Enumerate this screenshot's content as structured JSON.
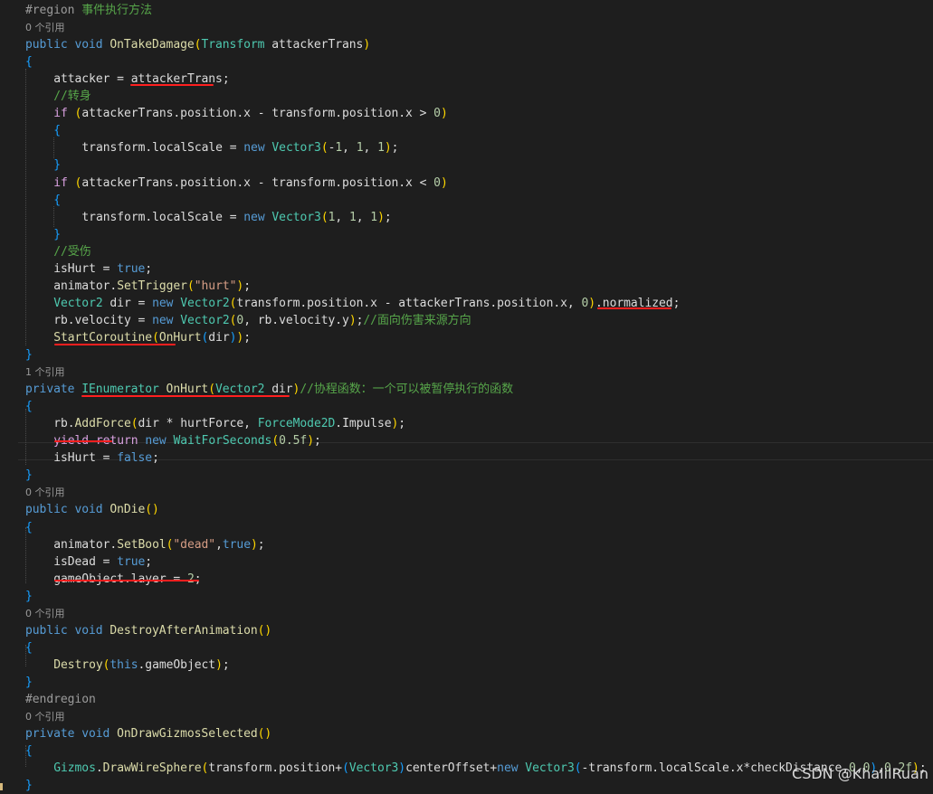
{
  "editor": {
    "colors": {
      "background": "#1e1e1e",
      "keyword": "#569cd6",
      "control": "#d8a0df",
      "type": "#4ec9b0",
      "method": "#dcdcaa",
      "comment": "#57a64a",
      "string": "#d69d85",
      "number": "#b5cea8",
      "annotation": "#ff1f1f"
    },
    "lines": [
      {
        "kind": "code",
        "indent": 0,
        "tokens": [
          [
            "pre",
            "#region "
          ],
          [
            "cmt",
            "事件执行方法"
          ]
        ]
      },
      {
        "kind": "lens",
        "text": "0 个引用"
      },
      {
        "kind": "code",
        "indent": 0,
        "tokens": [
          [
            "kw",
            "public"
          ],
          [
            "id",
            " "
          ],
          [
            "kw",
            "void"
          ],
          [
            "id",
            " "
          ],
          [
            "method",
            "OnTakeDamage"
          ],
          [
            "br2",
            "("
          ],
          [
            "type",
            "Transform"
          ],
          [
            "id",
            " attackerTrans"
          ],
          [
            "br2",
            ")"
          ]
        ]
      },
      {
        "kind": "code",
        "indent": 0,
        "tokens": [
          [
            "br",
            "{"
          ]
        ]
      },
      {
        "kind": "code",
        "indent": 1,
        "tokens": [
          [
            "id",
            "attacker = attackerTrans;"
          ]
        ]
      },
      {
        "kind": "code",
        "indent": 1,
        "tokens": [
          [
            "cmt",
            "//转身"
          ]
        ]
      },
      {
        "kind": "code",
        "indent": 1,
        "tokens": [
          [
            "ctl",
            "if"
          ],
          [
            "id",
            " "
          ],
          [
            "br2",
            "("
          ],
          [
            "id",
            "attackerTrans.position.x - transform.position.x > "
          ],
          [
            "num",
            "0"
          ],
          [
            "br2",
            ")"
          ]
        ]
      },
      {
        "kind": "code",
        "indent": 1,
        "tokens": [
          [
            "br",
            "{"
          ]
        ]
      },
      {
        "kind": "code",
        "indent": 2,
        "tokens": [
          [
            "id",
            "transform.localScale = "
          ],
          [
            "kw",
            "new"
          ],
          [
            "id",
            " "
          ],
          [
            "type",
            "Vector3"
          ],
          [
            "br2",
            "("
          ],
          [
            "id",
            "-"
          ],
          [
            "num",
            "1"
          ],
          [
            "id",
            ", "
          ],
          [
            "num",
            "1"
          ],
          [
            "id",
            ", "
          ],
          [
            "num",
            "1"
          ],
          [
            "br2",
            ")"
          ],
          [
            "id",
            ";"
          ]
        ]
      },
      {
        "kind": "code",
        "indent": 1,
        "tokens": [
          [
            "br",
            "}"
          ]
        ]
      },
      {
        "kind": "code",
        "indent": 1,
        "tokens": [
          [
            "ctl",
            "if"
          ],
          [
            "id",
            " "
          ],
          [
            "br2",
            "("
          ],
          [
            "id",
            "attackerTrans.position.x - transform.position.x < "
          ],
          [
            "num",
            "0"
          ],
          [
            "br2",
            ")"
          ]
        ]
      },
      {
        "kind": "code",
        "indent": 1,
        "tokens": [
          [
            "br",
            "{"
          ]
        ]
      },
      {
        "kind": "code",
        "indent": 2,
        "tokens": [
          [
            "id",
            "transform.localScale = "
          ],
          [
            "kw",
            "new"
          ],
          [
            "id",
            " "
          ],
          [
            "type",
            "Vector3"
          ],
          [
            "br2",
            "("
          ],
          [
            "num",
            "1"
          ],
          [
            "id",
            ", "
          ],
          [
            "num",
            "1"
          ],
          [
            "id",
            ", "
          ],
          [
            "num",
            "1"
          ],
          [
            "br2",
            ")"
          ],
          [
            "id",
            ";"
          ]
        ]
      },
      {
        "kind": "code",
        "indent": 1,
        "tokens": [
          [
            "br",
            "}"
          ]
        ]
      },
      {
        "kind": "code",
        "indent": 1,
        "tokens": [
          [
            "cmt",
            "//受伤"
          ]
        ]
      },
      {
        "kind": "code",
        "indent": 1,
        "tokens": [
          [
            "id",
            "isHurt = "
          ],
          [
            "kw",
            "true"
          ],
          [
            "id",
            ";"
          ]
        ]
      },
      {
        "kind": "code",
        "indent": 1,
        "tokens": [
          [
            "id",
            "animator."
          ],
          [
            "method",
            "SetTrigger"
          ],
          [
            "br2",
            "("
          ],
          [
            "str",
            "\"hurt\""
          ],
          [
            "br2",
            ")"
          ],
          [
            "id",
            ";"
          ]
        ]
      },
      {
        "kind": "code",
        "indent": 1,
        "tokens": [
          [
            "type",
            "Vector2"
          ],
          [
            "id",
            " dir = "
          ],
          [
            "kw",
            "new"
          ],
          [
            "id",
            " "
          ],
          [
            "type",
            "Vector2"
          ],
          [
            "br2",
            "("
          ],
          [
            "id",
            "transform.position.x - attackerTrans.position.x, "
          ],
          [
            "num",
            "0"
          ],
          [
            "br2",
            ")"
          ],
          [
            "id",
            ".normalized;"
          ]
        ]
      },
      {
        "kind": "code",
        "indent": 1,
        "tokens": [
          [
            "id",
            "rb.velocity = "
          ],
          [
            "kw",
            "new"
          ],
          [
            "id",
            " "
          ],
          [
            "type",
            "Vector2"
          ],
          [
            "br2",
            "("
          ],
          [
            "num",
            "0"
          ],
          [
            "id",
            ", rb.velocity.y"
          ],
          [
            "br2",
            ")"
          ],
          [
            "id",
            ";"
          ],
          [
            "cmt",
            "//面向伤害来源方向"
          ]
        ]
      },
      {
        "kind": "code",
        "indent": 1,
        "tokens": [
          [
            "method",
            "StartCoroutine"
          ],
          [
            "br2",
            "("
          ],
          [
            "method",
            "OnHurt"
          ],
          [
            "br",
            "("
          ],
          [
            "id",
            "dir"
          ],
          [
            "br",
            ")"
          ],
          [
            "br2",
            ")"
          ],
          [
            "id",
            ";"
          ]
        ]
      },
      {
        "kind": "code",
        "indent": 0,
        "tokens": [
          [
            "br",
            "}"
          ]
        ]
      },
      {
        "kind": "lens",
        "text": "1 个引用"
      },
      {
        "kind": "code",
        "indent": 0,
        "tokens": [
          [
            "kw",
            "private"
          ],
          [
            "id",
            " "
          ],
          [
            "type",
            "IEnumerator"
          ],
          [
            "id",
            " "
          ],
          [
            "method",
            "OnHurt"
          ],
          [
            "br2",
            "("
          ],
          [
            "type",
            "Vector2"
          ],
          [
            "id",
            " dir"
          ],
          [
            "br2",
            ")"
          ],
          [
            "cmt",
            "//协程函数：一个可以被暂停执行的函数"
          ]
        ]
      },
      {
        "kind": "code",
        "indent": 0,
        "tokens": [
          [
            "br",
            "{"
          ]
        ]
      },
      {
        "kind": "code",
        "indent": 1,
        "tokens": [
          [
            "id",
            "rb."
          ],
          [
            "method",
            "AddForce"
          ],
          [
            "br2",
            "("
          ],
          [
            "id",
            "dir * hurtForce, "
          ],
          [
            "type",
            "ForceMode2D"
          ],
          [
            "id",
            ".Impulse"
          ],
          [
            "br2",
            ")"
          ],
          [
            "id",
            ";"
          ]
        ]
      },
      {
        "kind": "code",
        "indent": 1,
        "tokens": [
          [
            "ctl",
            "yield"
          ],
          [
            "id",
            " "
          ],
          [
            "ctl",
            "return"
          ],
          [
            "id",
            " "
          ],
          [
            "kw",
            "new"
          ],
          [
            "id",
            " "
          ],
          [
            "type",
            "WaitForSeconds"
          ],
          [
            "br2",
            "("
          ],
          [
            "num",
            "0.5f"
          ],
          [
            "br2",
            ")"
          ],
          [
            "id",
            ";"
          ]
        ]
      },
      {
        "kind": "code",
        "indent": 1,
        "tokens": [
          [
            "id",
            "isHurt = "
          ],
          [
            "kw",
            "false"
          ],
          [
            "id",
            ";"
          ]
        ]
      },
      {
        "kind": "code",
        "indent": 0,
        "tokens": [
          [
            "br",
            "}"
          ]
        ]
      },
      {
        "kind": "lens",
        "text": "0 个引用"
      },
      {
        "kind": "code",
        "indent": 0,
        "tokens": [
          [
            "kw",
            "public"
          ],
          [
            "id",
            " "
          ],
          [
            "kw",
            "void"
          ],
          [
            "id",
            " "
          ],
          [
            "method",
            "OnDie"
          ],
          [
            "br2",
            "()"
          ]
        ]
      },
      {
        "kind": "code",
        "indent": 0,
        "tokens": [
          [
            "br",
            "{"
          ]
        ]
      },
      {
        "kind": "code",
        "indent": 1,
        "tokens": [
          [
            "id",
            "animator."
          ],
          [
            "method",
            "SetBool"
          ],
          [
            "br2",
            "("
          ],
          [
            "str",
            "\"dead\""
          ],
          [
            "id",
            ","
          ],
          [
            "kw",
            "true"
          ],
          [
            "br2",
            ")"
          ],
          [
            "id",
            ";"
          ]
        ]
      },
      {
        "kind": "code",
        "indent": 1,
        "tokens": [
          [
            "id",
            "isDead = "
          ],
          [
            "kw",
            "true"
          ],
          [
            "id",
            ";"
          ]
        ]
      },
      {
        "kind": "code",
        "indent": 1,
        "tokens": [
          [
            "id",
            "gameObject.layer = "
          ],
          [
            "num",
            "2"
          ],
          [
            "id",
            ";"
          ]
        ]
      },
      {
        "kind": "code",
        "indent": 0,
        "tokens": [
          [
            "br",
            "}"
          ]
        ]
      },
      {
        "kind": "lens",
        "text": "0 个引用"
      },
      {
        "kind": "code",
        "indent": 0,
        "tokens": [
          [
            "kw",
            "public"
          ],
          [
            "id",
            " "
          ],
          [
            "kw",
            "void"
          ],
          [
            "id",
            " "
          ],
          [
            "method",
            "DestroyAfterAnimation"
          ],
          [
            "br2",
            "()"
          ]
        ]
      },
      {
        "kind": "code",
        "indent": 0,
        "tokens": [
          [
            "br",
            "{"
          ]
        ]
      },
      {
        "kind": "code",
        "indent": 1,
        "tokens": [
          [
            "method",
            "Destroy"
          ],
          [
            "br2",
            "("
          ],
          [
            "kw",
            "this"
          ],
          [
            "id",
            ".gameObject"
          ],
          [
            "br2",
            ")"
          ],
          [
            "id",
            ";"
          ]
        ]
      },
      {
        "kind": "code",
        "indent": 0,
        "tokens": [
          [
            "br",
            "}"
          ]
        ]
      },
      {
        "kind": "code",
        "indent": 0,
        "tokens": [
          [
            "pre",
            "#endregion"
          ]
        ]
      },
      {
        "kind": "lens",
        "text": "0 个引用"
      },
      {
        "kind": "code",
        "indent": 0,
        "tokens": [
          [
            "kw",
            "private"
          ],
          [
            "id",
            " "
          ],
          [
            "kw",
            "void"
          ],
          [
            "id",
            " "
          ],
          [
            "method",
            "OnDrawGizmosSelected"
          ],
          [
            "br2",
            "()"
          ]
        ]
      },
      {
        "kind": "code",
        "indent": 0,
        "tokens": [
          [
            "br",
            "{"
          ]
        ]
      },
      {
        "kind": "code",
        "indent": 1,
        "tokens": [
          [
            "type",
            "Gizmos"
          ],
          [
            "id",
            "."
          ],
          [
            "method",
            "DrawWireSphere"
          ],
          [
            "br2",
            "("
          ],
          [
            "id",
            "transform.position+"
          ],
          [
            "br",
            "("
          ],
          [
            "type",
            "Vector3"
          ],
          [
            "br",
            ")"
          ],
          [
            "id",
            "centerOffset+"
          ],
          [
            "kw",
            "new"
          ],
          [
            "id",
            " "
          ],
          [
            "type",
            "Vector3"
          ],
          [
            "br",
            "("
          ],
          [
            "id",
            "-transform.localScale.x*checkDistance,"
          ],
          [
            "num",
            "0"
          ],
          [
            "id",
            ","
          ],
          [
            "num",
            "0"
          ],
          [
            "br",
            ")"
          ],
          [
            "id",
            ","
          ],
          [
            "num",
            "0.2f"
          ],
          [
            "br2",
            ")"
          ],
          [
            "id",
            ";"
          ]
        ]
      },
      {
        "kind": "code",
        "indent": 0,
        "tokens": [
          [
            "br",
            "}"
          ]
        ]
      }
    ]
  },
  "watermark": "CSDN @KhalilRuan"
}
